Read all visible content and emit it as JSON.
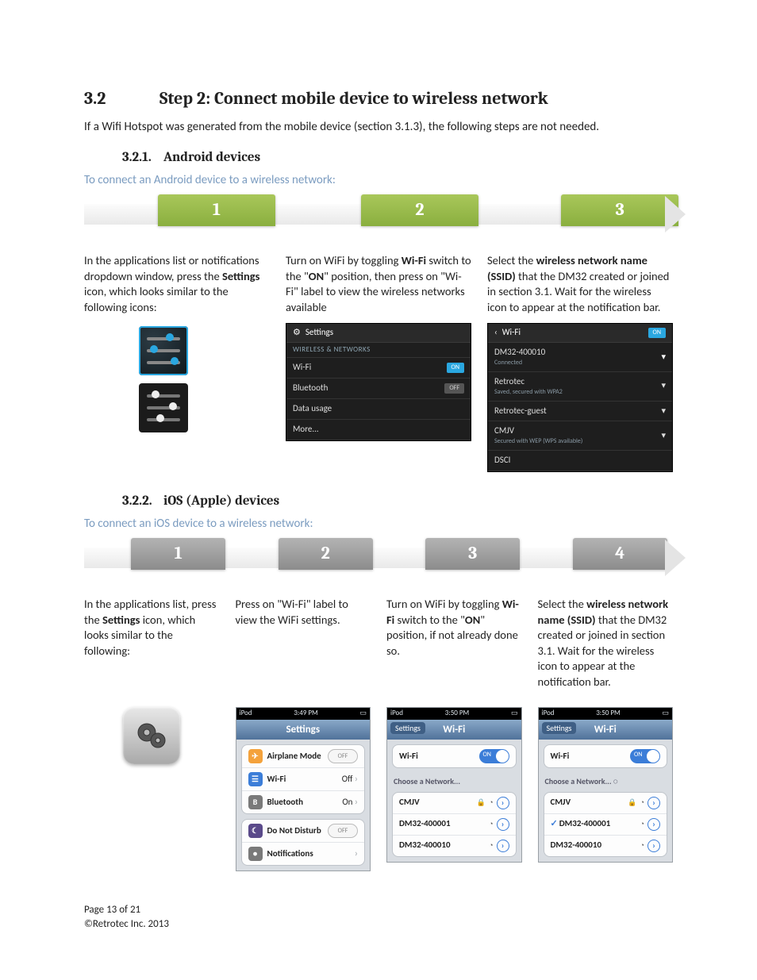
{
  "heading": {
    "num": "3.2",
    "title": "Step 2: Connect mobile device to wireless network"
  },
  "intro": "If a Wifi Hotspot was generated from the mobile device (section 3.1.3), the following steps are not needed.",
  "android": {
    "head_num": "3.2.1.",
    "head_title": "Android devices",
    "lead": "To connect an Android device to a wireless network:",
    "steps": [
      "1",
      "2",
      "3"
    ],
    "col1": {
      "pre": "In the applications list or notifications dropdown window, press the ",
      "bold": "Settings",
      "post": " icon, which looks similar to the following icons:"
    },
    "col2": {
      "pre": "Turn on WiFi by toggling ",
      "bold": "Wi-Fi",
      "mid": " switch to the \"",
      "bold2": "ON",
      "post": "\" position, then press on \"Wi-Fi\" label to view the wireless networks available"
    },
    "col3": {
      "pre": "Select the ",
      "bold": "wireless network name (SSID)",
      "post": " that the DM32 created or joined in section 3.1. Wait for the wireless icon to appear at the notification bar."
    },
    "shot_settings": {
      "title": "Settings",
      "section": "WIRELESS & NETWORKS",
      "rows": [
        {
          "label": "Wi-Fi",
          "state": "ON"
        },
        {
          "label": "Bluetooth",
          "state": "OFF"
        },
        {
          "label": "Data usage",
          "state": ""
        },
        {
          "label": "More...",
          "state": ""
        }
      ]
    },
    "shot_wifi": {
      "title": "Wi-Fi",
      "on": "ON",
      "nets": [
        {
          "name": "DM32-400010",
          "sub": "Connected"
        },
        {
          "name": "Retrotec",
          "sub": "Saved, secured with WPA2"
        },
        {
          "name": "Retrotec-guest",
          "sub": ""
        },
        {
          "name": "CMJV",
          "sub": "Secured with WEP (WPS available)"
        },
        {
          "name": "DSCI",
          "sub": ""
        }
      ]
    }
  },
  "ios": {
    "head_num": "3.2.2.",
    "head_title": "iOS (Apple) devices",
    "lead": "To connect an iOS device to a wireless network:",
    "steps": [
      "1",
      "2",
      "3",
      "4"
    ],
    "col1": {
      "pre": "In the applications list, press the ",
      "bold": "Settings",
      "post": " icon, which looks similar to the following:"
    },
    "col2": "Press on \"Wi-Fi\" label to view the WiFi settings.",
    "col3": {
      "pre": "Turn on WiFi by toggling ",
      "bold": "Wi-Fi",
      "mid": " switch to the \"",
      "bold2": "ON",
      "post": "\" position, if not already done so."
    },
    "col4": {
      "pre": "Select the ",
      "bold": "wireless network name (SSID)",
      "post": " that the DM32 created or joined in section 3.1. Wait for the wireless icon to appear at the notification bar."
    },
    "shot_settings": {
      "status_left": "iPod",
      "status_mid": "3:49 PM",
      "title": "Settings",
      "rows": [
        {
          "icon": "orange",
          "glyph": "✈",
          "label": "Airplane Mode",
          "right_type": "toggle_off",
          "right": "OFF"
        },
        {
          "icon": "blue",
          "glyph": "?",
          "label": "Wi-Fi",
          "right_type": "text",
          "right": "Off"
        },
        {
          "icon": "gray",
          "glyph": "B",
          "label": "Bluetooth",
          "right_type": "text",
          "right": "On"
        },
        {
          "icon": "moon",
          "glyph": "☾",
          "label": "Do Not Disturb",
          "right_type": "toggle_off",
          "right": "OFF"
        },
        {
          "icon": "gray",
          "glyph": "●",
          "label": "Notifications",
          "right_type": "chev",
          "right": ""
        }
      ]
    },
    "shot_wifi_a": {
      "status_left": "iPod",
      "status_mid": "3:50 PM",
      "back": "Settings",
      "title": "Wi-Fi",
      "wifi_label": "Wi-Fi",
      "choose": "Choose a Network...",
      "nets": [
        {
          "name": "CMJV",
          "lock": true,
          "sel": false
        },
        {
          "name": "DM32-400001",
          "lock": false,
          "sel": false
        },
        {
          "name": "DM32-400010",
          "lock": false,
          "sel": false
        }
      ]
    },
    "shot_wifi_b": {
      "status_left": "iPod",
      "status_mid": "3:50 PM",
      "back": "Settings",
      "title": "Wi-Fi",
      "wifi_label": "Wi-Fi",
      "choose": "Choose a Network...",
      "nets": [
        {
          "name": "CMJV",
          "lock": true,
          "sel": false
        },
        {
          "name": "DM32-400001",
          "lock": false,
          "sel": true
        },
        {
          "name": "DM32-400010",
          "lock": false,
          "sel": false
        }
      ]
    }
  },
  "footer": {
    "page": "Page 13 of 21",
    "copy": "©Retrotec Inc. 2013"
  }
}
